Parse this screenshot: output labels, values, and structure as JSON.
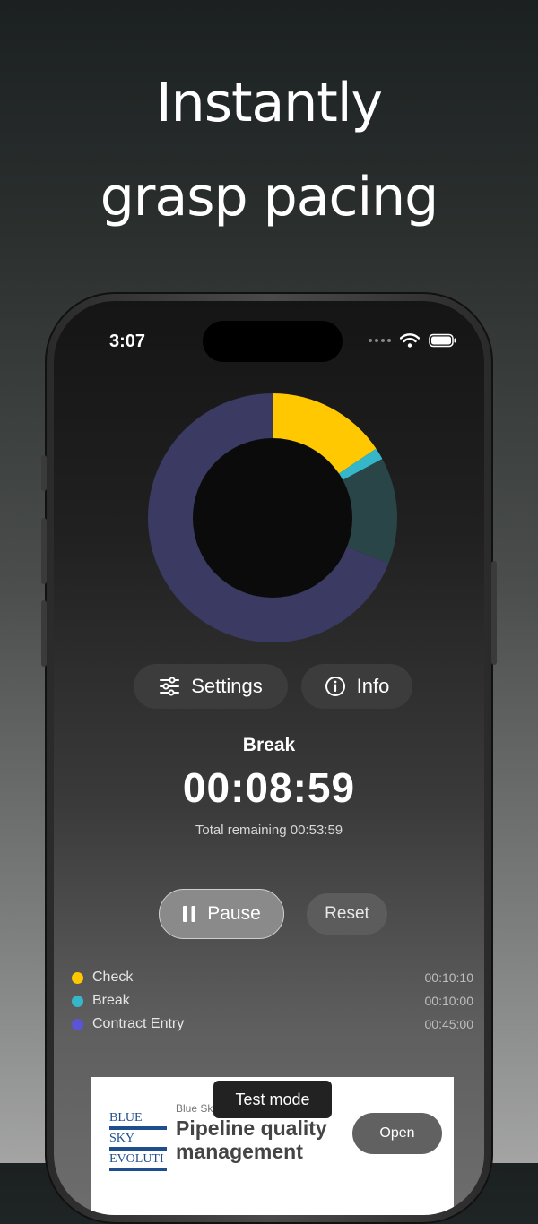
{
  "marketing": {
    "headline_line1": "Instantly",
    "headline_line2": "grasp pacing"
  },
  "status_bar": {
    "time": "3:07"
  },
  "chart_data": {
    "type": "pie",
    "categories": [
      "Check",
      "Break",
      "Contract Entry"
    ],
    "series": [
      {
        "values": [
          10.17,
          10.0,
          45.0
        ]
      }
    ],
    "elapsed_fraction_of_break": 0.1,
    "colors": [
      "#ffc800",
      "#36b7c9",
      "#3a3a63"
    ],
    "elapsed_color": "#2a4547"
  },
  "controls": {
    "settings_label": "Settings",
    "info_label": "Info",
    "pause_label": "Pause",
    "reset_label": "Reset"
  },
  "timer": {
    "phase": "Break",
    "time": "00:08:59",
    "total_remaining": "Total remaining 00:53:59"
  },
  "legend": [
    {
      "label": "Check",
      "time": "00:10:10",
      "color": "#ffc800"
    },
    {
      "label": "Break",
      "time": "00:10:00",
      "color": "#36b7c9"
    },
    {
      "label": "Contract Entry",
      "time": "00:45:00",
      "color": "#5b54d6"
    }
  ],
  "ad": {
    "logo_lines": [
      "BLUE",
      "SKY",
      "EVOLUTI"
    ],
    "brand": "Blue Sky",
    "title": "Pipeline quality management",
    "open_label": "Open",
    "test_mode_label": "Test mode"
  }
}
